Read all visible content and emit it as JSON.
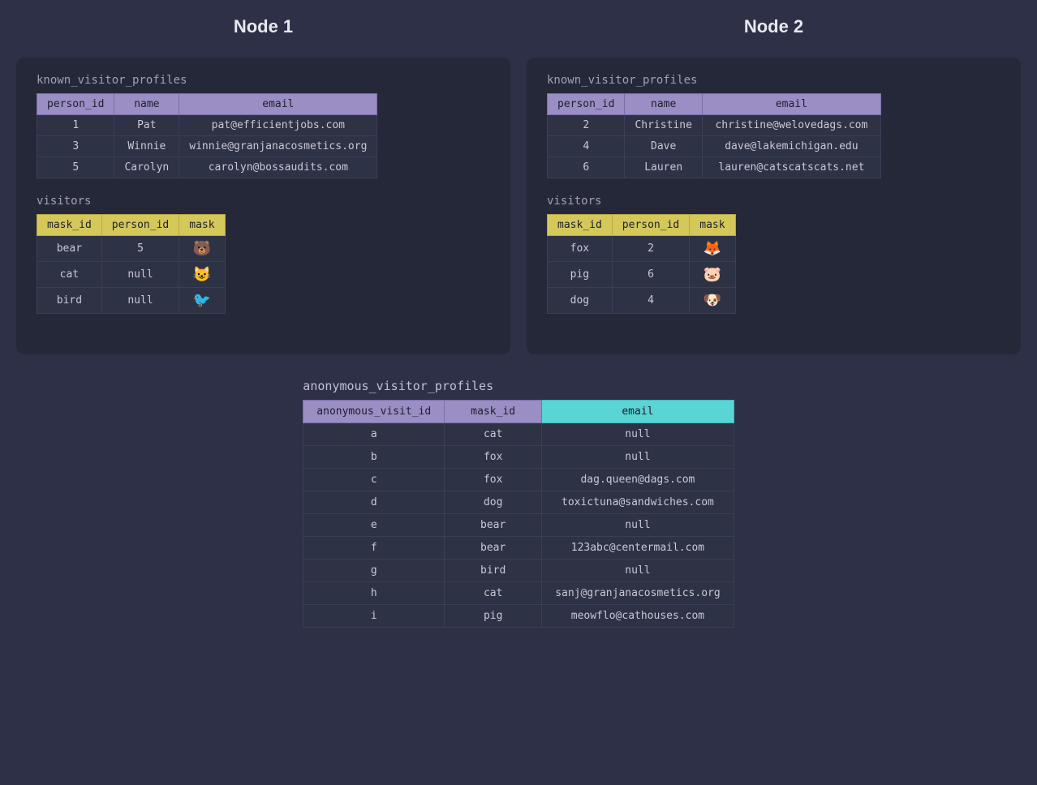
{
  "node1": {
    "title": "Node 1",
    "known_profiles": {
      "label": "known_visitor_profiles",
      "columns": [
        "person_id",
        "name",
        "email"
      ],
      "rows": [
        [
          "1",
          "Pat",
          "pat@efficientjobs.com"
        ],
        [
          "3",
          "Winnie",
          "winnie@granjanacosmetics.org"
        ],
        [
          "5",
          "Carolyn",
          "carolyn@bossaudits.com"
        ]
      ]
    },
    "visitors": {
      "label": "visitors",
      "columns": [
        "mask_id",
        "person_id",
        "mask"
      ],
      "rows": [
        [
          "bear",
          "5",
          "🐻"
        ],
        [
          "cat",
          "null",
          "😺"
        ],
        [
          "bird",
          "null",
          "🐦"
        ]
      ]
    }
  },
  "node2": {
    "title": "Node 2",
    "known_profiles": {
      "label": "known_visitor_profiles",
      "columns": [
        "person_id",
        "name",
        "email"
      ],
      "rows": [
        [
          "2",
          "Christine",
          "christine@welovedags.com"
        ],
        [
          "4",
          "Dave",
          "dave@lakemichigan.edu"
        ],
        [
          "6",
          "Lauren",
          "lauren@catscatscats.net"
        ]
      ]
    },
    "visitors": {
      "label": "visitors",
      "columns": [
        "mask_id",
        "person_id",
        "mask"
      ],
      "rows": [
        [
          "fox",
          "2",
          "🦊"
        ],
        [
          "pig",
          "6",
          "🐷"
        ],
        [
          "dog",
          "4",
          "🐶"
        ]
      ]
    }
  },
  "anonymous": {
    "label": "anonymous_visitor_profiles",
    "columns": [
      "anonymous_visit_id",
      "mask_id",
      "email"
    ],
    "rows": [
      [
        "a",
        "cat",
        "null"
      ],
      [
        "b",
        "fox",
        "null"
      ],
      [
        "c",
        "fox",
        "dag.queen@dags.com"
      ],
      [
        "d",
        "dog",
        "toxictuna@sandwiches.com"
      ],
      [
        "e",
        "bear",
        "null"
      ],
      [
        "f",
        "bear",
        "123abc@centermail.com"
      ],
      [
        "g",
        "bird",
        "null"
      ],
      [
        "h",
        "cat",
        "sanj@granjanacosmetics.org"
      ],
      [
        "i",
        "pig",
        "meowflo@cathouses.com"
      ]
    ]
  }
}
